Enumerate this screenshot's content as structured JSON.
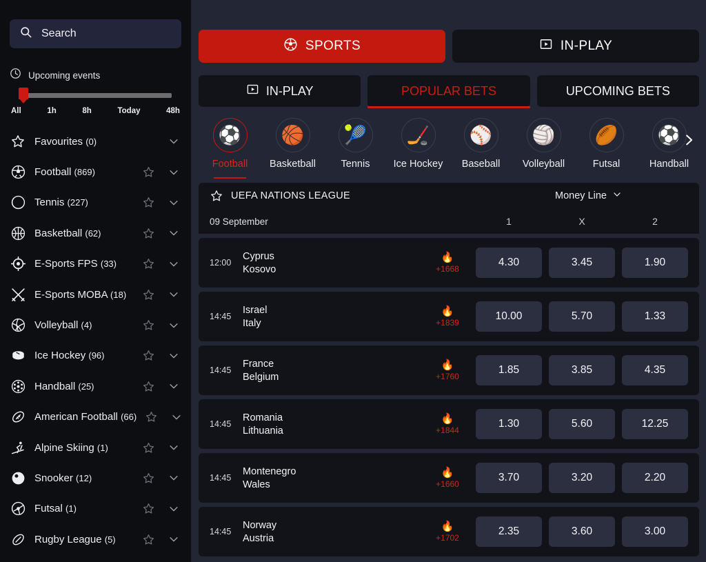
{
  "colors": {
    "accent_red": "#c4190f",
    "sidebar_bg": "#0d0e11",
    "main_bg": "#222635",
    "card_bg": "#121318",
    "odd_bg": "#2b2f40",
    "hot_orange": "#ff7a18"
  },
  "sidebar": {
    "search": {
      "placeholder": "Search",
      "value": ""
    },
    "upcoming": {
      "title": "Upcoming events",
      "clock_icon": "clock-icon",
      "marks": [
        "All",
        "1h",
        "8h",
        "Today",
        "48h"
      ],
      "selected": "All"
    },
    "items": [
      {
        "label": "Favourites",
        "count": "(0)",
        "icon": "star-icon",
        "has_star": false
      },
      {
        "label": "Football",
        "count": "(869)",
        "icon": "football-icon",
        "has_star": true
      },
      {
        "label": "Tennis",
        "count": "(227)",
        "icon": "tennis-icon",
        "has_star": true
      },
      {
        "label": "Basketball",
        "count": "(62)",
        "icon": "basketball-icon",
        "has_star": true
      },
      {
        "label": "E-Sports FPS",
        "count": "(33)",
        "icon": "crosshair-icon",
        "has_star": true
      },
      {
        "label": "E-Sports MOBA",
        "count": "(18)",
        "icon": "swords-icon",
        "has_star": true
      },
      {
        "label": "Volleyball",
        "count": "(4)",
        "icon": "volleyball-icon",
        "has_star": true
      },
      {
        "label": "Ice Hockey",
        "count": "(96)",
        "icon": "hockey-puck-icon",
        "has_star": true
      },
      {
        "label": "Handball",
        "count": "(25)",
        "icon": "handball-icon",
        "has_star": true
      },
      {
        "label": "American Football",
        "count": "(66)",
        "icon": "american-football-icon",
        "has_star": true
      },
      {
        "label": "Alpine Skiing",
        "count": "(1)",
        "icon": "skiing-icon",
        "has_star": true
      },
      {
        "label": "Snooker",
        "count": "(12)",
        "icon": "snooker-ball-icon",
        "has_star": true
      },
      {
        "label": "Futsal",
        "count": "(1)",
        "icon": "futsal-icon",
        "has_star": true
      },
      {
        "label": "Rugby League",
        "count": "(5)",
        "icon": "rugby-ball-icon",
        "has_star": true
      }
    ]
  },
  "top_tabs": [
    {
      "label": "SPORTS",
      "icon": "football-icon",
      "active": true
    },
    {
      "label": "IN-PLAY",
      "icon": "play-box-icon",
      "active": false
    }
  ],
  "sub_tabs": [
    {
      "label": "IN-PLAY",
      "icon": "play-box-icon",
      "active": false
    },
    {
      "label": "POPULAR BETS",
      "icon": "",
      "active": true
    },
    {
      "label": "UPCOMING BETS",
      "icon": "",
      "active": false
    }
  ],
  "sports_strip": {
    "next_icon": "chevron-right-icon",
    "items": [
      {
        "name": "Football",
        "glyph": "⚽",
        "active": true
      },
      {
        "name": "Basketball",
        "glyph": "🏀",
        "active": false
      },
      {
        "name": "Tennis",
        "glyph": "🎾",
        "active": false
      },
      {
        "name": "Ice Hockey",
        "glyph": "🏒",
        "active": false
      },
      {
        "name": "Baseball",
        "glyph": "⚾",
        "active": false
      },
      {
        "name": "Volleyball",
        "glyph": "🏐",
        "active": false
      },
      {
        "name": "Futsal",
        "glyph": "🏉",
        "active": false
      },
      {
        "name": "Handball",
        "glyph": "⚽",
        "active": false
      }
    ]
  },
  "league": {
    "star_icon": "star-icon",
    "name": "UEFA NATIONS LEAGUE",
    "market": "Money Line",
    "market_chevron": "chevron-down-icon",
    "date": "09 September",
    "columns": [
      "1",
      "X",
      "2"
    ]
  },
  "matches": [
    {
      "time": "12:00",
      "home": "Cyprus",
      "away": "Kosovo",
      "fire": "🔥",
      "extra": "+1668",
      "odds": [
        "4.30",
        "3.45",
        "1.90"
      ]
    },
    {
      "time": "14:45",
      "home": "Israel",
      "away": "Italy",
      "fire": "🔥",
      "extra": "+1839",
      "odds": [
        "10.00",
        "5.70",
        "1.33"
      ]
    },
    {
      "time": "14:45",
      "home": "France",
      "away": "Belgium",
      "fire": "🔥",
      "extra": "+1760",
      "odds": [
        "1.85",
        "3.85",
        "4.35"
      ]
    },
    {
      "time": "14:45",
      "home": "Romania",
      "away": "Lithuania",
      "fire": "🔥",
      "extra": "+1844",
      "odds": [
        "1.30",
        "5.60",
        "12.25"
      ]
    },
    {
      "time": "14:45",
      "home": "Montenegro",
      "away": "Wales",
      "fire": "🔥",
      "extra": "+1660",
      "odds": [
        "3.70",
        "3.20",
        "2.20"
      ]
    },
    {
      "time": "14:45",
      "home": "Norway",
      "away": "Austria",
      "fire": "🔥",
      "extra": "+1702",
      "odds": [
        "2.35",
        "3.60",
        "3.00"
      ]
    }
  ]
}
